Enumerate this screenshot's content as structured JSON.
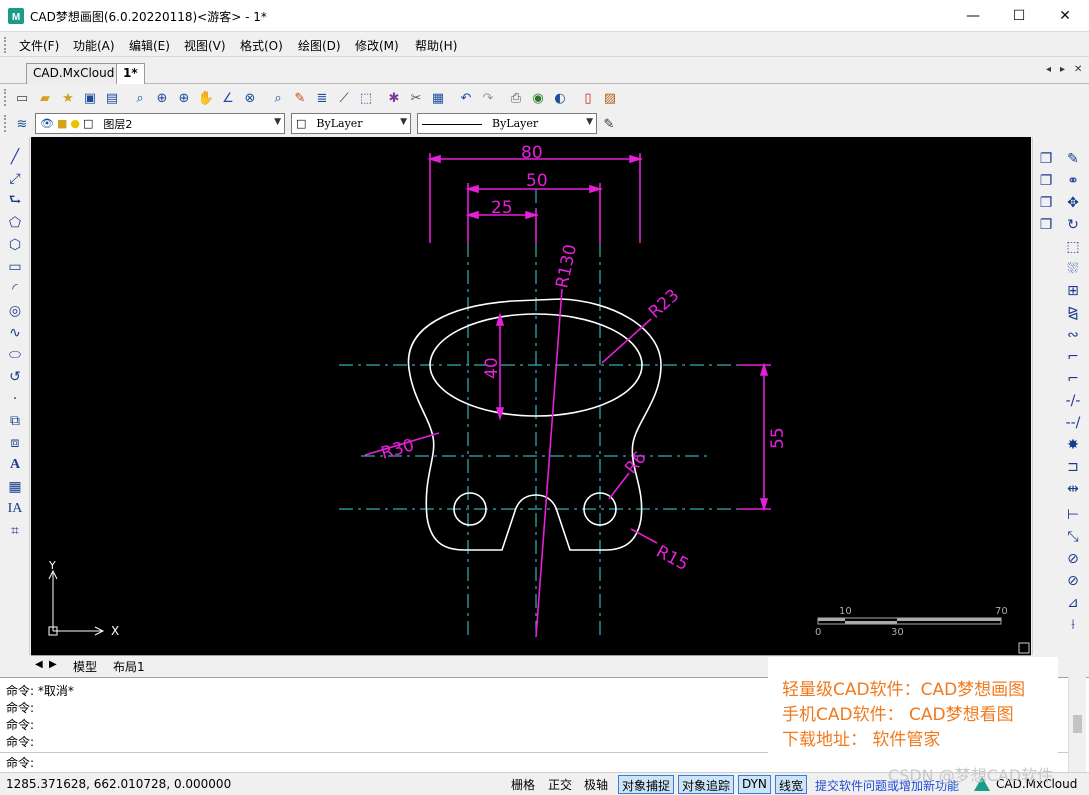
{
  "window": {
    "title": "CAD梦想画图(6.0.20220118)<游客> - 1*",
    "minimize": "—",
    "maximize": "☐",
    "close": "✕"
  },
  "menu": [
    "文件(F)",
    "功能(A)",
    "编辑(E)",
    "视图(V)",
    "格式(O)",
    "绘图(D)",
    "修改(M)",
    "帮助(H)"
  ],
  "tabs": [
    {
      "label": "CAD.MxCloud",
      "active": false
    },
    {
      "label": "1*",
      "active": true
    }
  ],
  "tab_nav": [
    "◂",
    "▸",
    "✕"
  ],
  "layer_bar": {
    "layer_name": "图层2",
    "color_value": "ByLayer",
    "linetype_value": "ByLayer"
  },
  "drawing": {
    "dims": {
      "d80": "80",
      "d50": "50",
      "d25": "25",
      "d40": "40",
      "d55": "55",
      "r130": "R130",
      "r23": "R23",
      "r30": "R30",
      "r6": "R6",
      "r15": "R15"
    },
    "scale_labels": {
      "s10": "10",
      "s70": "70",
      "s0": "0",
      "s30": "30"
    },
    "ucs": {
      "x": "X",
      "y": "Y"
    },
    "colors": {
      "dimension": "#e61fd9",
      "centerline": "#3fd6d6",
      "geometry": "#ffffff",
      "background": "#000000"
    }
  },
  "layout_tabs": [
    "模型",
    "布局1"
  ],
  "command_lines": [
    "命令:   *取消*",
    "命令:",
    "命令:",
    "命令:",
    "命令:"
  ],
  "promo": [
    "轻量级CAD软件：CAD梦想画图",
    "手机CAD软件：  CAD梦想看图",
    "下载地址：     软件管家"
  ],
  "status": {
    "coords": "1285.371628,  662.010728,  0.000000",
    "buttons": [
      {
        "label": "栅格",
        "on": false
      },
      {
        "label": "正交",
        "on": false
      },
      {
        "label": "极轴",
        "on": false
      },
      {
        "label": "对象捕捉",
        "on": true
      },
      {
        "label": "对象追踪",
        "on": true
      },
      {
        "label": "DYN",
        "on": true
      },
      {
        "label": "线宽",
        "on": true
      }
    ],
    "link": "提交软件问题或增加新功能",
    "brand": "CAD.MxCloud",
    "watermark": "CSDN @梦想CAD软件"
  }
}
